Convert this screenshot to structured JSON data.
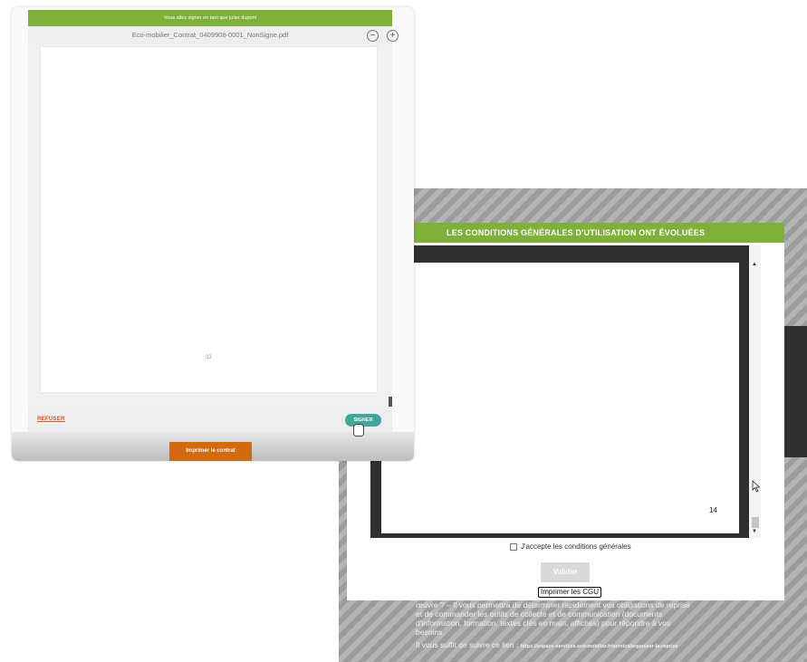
{
  "sign_window": {
    "banner": "Vous allez signer en tant que julier dupont",
    "filename": "Eco-mobilier_Contrat_0409908-0001_NonSigne.pdf",
    "zoom_out": "−",
    "zoom_in": "+",
    "page_number": "33",
    "refuse_label": "REFUSER",
    "sign_label": "SIGNER",
    "print_label": "Imprimer le contrat"
  },
  "cgu_window": {
    "header": "LES CONDITIONS GÉNÉRALES D'UTILISATION ONT ÉVOLUÉES",
    "page_number": "14",
    "scroll_up": "▲",
    "scroll_down": "▼",
    "accept_label": "J'accepte les conditions générales",
    "validate_label": "Valider",
    "print_label": "Imprimer les CGU",
    "background_text": [
      "œuvre ? – Il vous permettra de déterminer rapidement vos obligations de reprise",
      "et de commander les outils de collecte et de communication (documents",
      "d'information, formation, textes clés en main, affiches) pour répondre à vos",
      "besoins."
    ],
    "link_intro": "Il vous suffit de suivre ce lien : ",
    "link_url": "https://espace-services.eco-mobilier.fr/service/organiser-la-reprise"
  },
  "icons": {
    "cursor": "arrow-cursor-icon",
    "hand": "hand-pointer-icon"
  }
}
